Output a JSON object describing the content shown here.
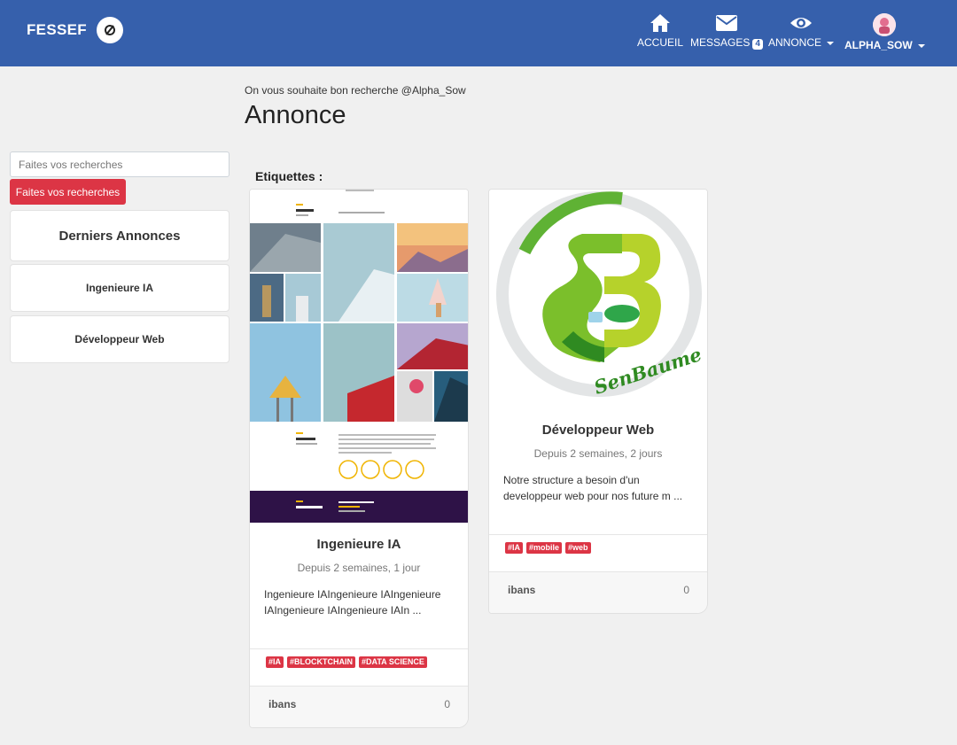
{
  "navbar": {
    "brand": "FESSEF",
    "items": [
      {
        "label": "ACCUEIL",
        "icon": "home-icon"
      },
      {
        "label": "MESSAGES",
        "icon": "envelope-icon",
        "badge": "4"
      },
      {
        "label": "ANNONCE",
        "icon": "eye-icon"
      },
      {
        "label": "ALPHA_SOW",
        "icon": "avatar"
      }
    ]
  },
  "header": {
    "greeting": "On vous souhaite bon recherche @Alpha_Sow",
    "title": "Annonce"
  },
  "sidebar": {
    "search_placeholder": "Faites vos recherches",
    "search_button": "Faites vos recherches",
    "latest_title": "Derniers Annonces",
    "items": [
      "Ingenieure IA",
      "Développeur Web"
    ]
  },
  "main": {
    "tags_heading": "Etiquettes :",
    "cards": [
      {
        "title": "Ingenieure IA",
        "date": "Depuis 2 semaines, 1 jour",
        "description": "Ingenieure IAIngenieure IAIngenieure IAIngenieure IAIngenieure IAIn ...",
        "tags": [
          "#IA",
          "#BLOCKTCHAIN",
          "#DATA SCIENCE"
        ],
        "author": "ibans",
        "count": "0",
        "image": "portfolio-screenshot"
      },
      {
        "title": "Développeur Web",
        "date": "Depuis 2 semaines, 2 jours",
        "description": "Notre structure a besoin d'un developpeur web pour nos future m ...",
        "tags": [
          "#IA",
          "#mobile",
          "#web"
        ],
        "author": "ibans",
        "count": "0",
        "image": "senbaume-logo",
        "logo_text": "SenBaume"
      }
    ]
  },
  "colors": {
    "navbar": "#3660ac",
    "accent_red": "#dc3545",
    "background": "#f0f0f0"
  }
}
